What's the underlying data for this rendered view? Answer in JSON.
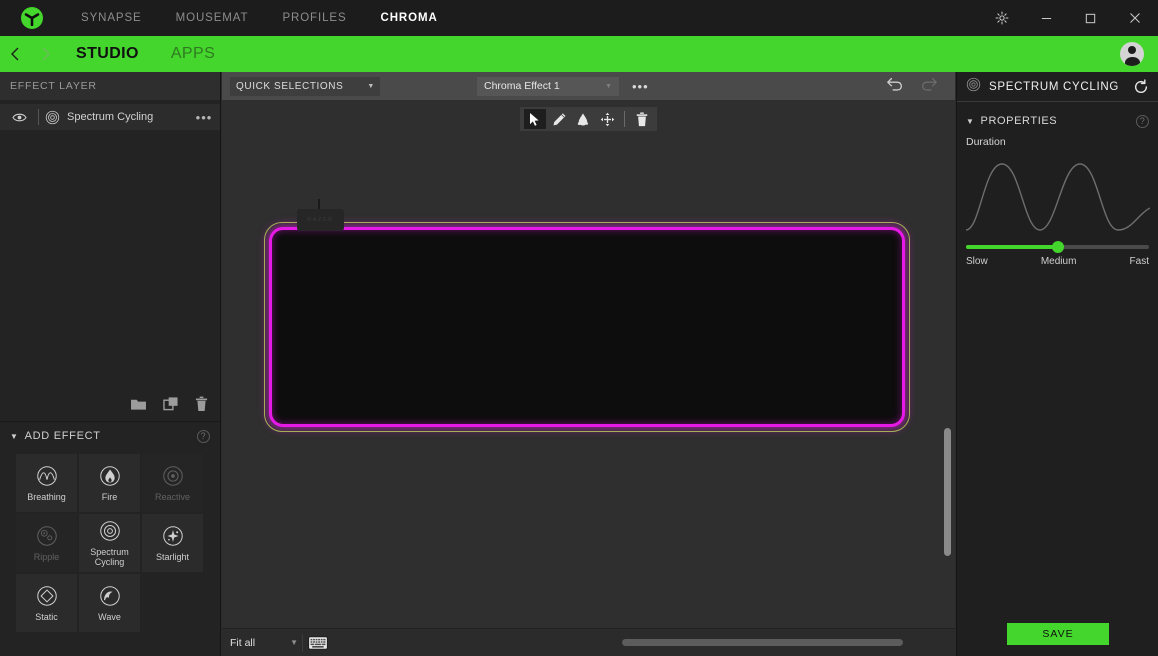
{
  "titlebar": {
    "logo_icon": "razer-logo-icon",
    "tabs": [
      {
        "label": "SYNAPSE",
        "active": false
      },
      {
        "label": "MOUSEMAT",
        "active": false
      },
      {
        "label": "PROFILES",
        "active": false
      },
      {
        "label": "CHROMA",
        "active": true
      }
    ],
    "window_controls": [
      {
        "name": "settings-gear-button",
        "icon": "gear-icon"
      },
      {
        "name": "minimize-button",
        "icon": "minimize-icon"
      },
      {
        "name": "maximize-button",
        "icon": "maximize-icon"
      },
      {
        "name": "close-button",
        "icon": "close-icon"
      }
    ]
  },
  "subheader": {
    "back_icon": "chevron-left-icon",
    "forward_icon": "chevron-right-icon",
    "tabs": [
      {
        "label": "STUDIO",
        "active": true
      },
      {
        "label": "APPS",
        "active": false
      }
    ],
    "avatar_icon": "user-avatar-icon"
  },
  "left_panel": {
    "header": "EFFECT LAYER",
    "layers": [
      {
        "name": "Spectrum Cycling",
        "visible": true,
        "eye_icon": "eye-icon",
        "effect_icon": "spectrum-cycling-icon",
        "more_label": "•••"
      }
    ],
    "layer_tools": [
      {
        "name": "new-folder-button",
        "icon": "folder-icon"
      },
      {
        "name": "duplicate-layer-button",
        "icon": "copy-icon"
      },
      {
        "name": "delete-layer-button",
        "icon": "trash-icon"
      }
    ],
    "add_effect": {
      "header": "ADD EFFECT",
      "help_label": "?",
      "effects": [
        {
          "label": "Breathing",
          "icon": "breathing-icon",
          "disabled": false
        },
        {
          "label": "Fire",
          "icon": "fire-icon",
          "disabled": false
        },
        {
          "label": "Reactive",
          "icon": "reactive-icon",
          "disabled": true
        },
        {
          "label": "Ripple",
          "icon": "ripple-icon",
          "disabled": true
        },
        {
          "label": "Spectrum Cycling",
          "icon": "spectrum-cycling-icon",
          "disabled": false
        },
        {
          "label": "Starlight",
          "icon": "starlight-icon",
          "disabled": false
        },
        {
          "label": "Static",
          "icon": "static-icon",
          "disabled": false
        },
        {
          "label": "Wave",
          "icon": "wave-icon",
          "disabled": false
        }
      ]
    }
  },
  "center": {
    "quick_selections": {
      "label": "QUICK SELECTIONS",
      "caret_icon": "chevron-down-icon"
    },
    "effect_select": {
      "value": "Chroma Effect 1",
      "caret_icon": "chevron-down-icon",
      "more_label": "•••"
    },
    "undo": {
      "name": "undo-button",
      "icon": "undo-icon",
      "enabled": true
    },
    "redo": {
      "name": "redo-button",
      "icon": "redo-icon",
      "enabled": false
    },
    "tools": [
      {
        "name": "select-tool",
        "icon": "cursor-icon",
        "active": true
      },
      {
        "name": "pencil-tool",
        "icon": "pencil-icon",
        "active": false
      },
      {
        "name": "paint-bucket-tool",
        "icon": "paint-bucket-icon",
        "active": false
      },
      {
        "name": "move-tool",
        "icon": "move-icon",
        "active": false
      },
      {
        "name": "delete-tool",
        "icon": "trash-icon",
        "active": false
      }
    ],
    "device": {
      "name": "razer-mousemat",
      "brand_text": "RAZER",
      "glow_color": "#e619e6",
      "selection_color": "#9bc93f"
    },
    "bottom": {
      "zoom_value": "Fit all",
      "zoom_caret_icon": "chevron-down-icon",
      "keyboard_icon": "keyboard-icon"
    }
  },
  "right_panel": {
    "effect_icon": "spectrum-cycling-icon",
    "title": "SPECTRUM CYCLING",
    "reset_icon": "reset-icon",
    "properties_header": "PROPERTIES",
    "help_label": "?",
    "duration_label": "Duration",
    "slider": {
      "value_percent": 50,
      "labels": [
        "Slow",
        "Medium",
        "Fast"
      ]
    },
    "save_label": "SAVE"
  },
  "colors": {
    "accent_green": "#44d62c",
    "glow_magenta": "#e619e6",
    "selection_green": "#9bc93f",
    "titlebar_bg": "#1c1c1c",
    "panel_bg": "#232323",
    "canvas_bg": "#2f2f2f"
  }
}
